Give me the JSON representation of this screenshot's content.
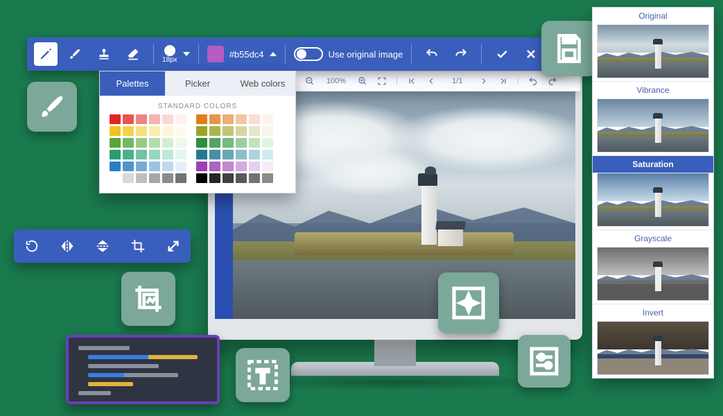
{
  "toolbar": {
    "brush_size_label": "18px",
    "hex_value": "#b55dc4",
    "use_original_label": "Use original image"
  },
  "palette_popup": {
    "tabs": [
      "Palettes",
      "Picker",
      "Web colors"
    ],
    "section_title": "STANDARD COLORS",
    "left_colors": [
      "#e02626",
      "#e85555",
      "#ef8383",
      "#f5b2b2",
      "#fbd8d8",
      "#fef0f0",
      "#f0c419",
      "#f3d34a",
      "#f6e17b",
      "#f9eead",
      "#fcf6d4",
      "#fefbee",
      "#5aa43a",
      "#78b85f",
      "#96cb84",
      "#b5dda9",
      "#d3eecf",
      "#edf8ea",
      "#2a9d6f",
      "#4eb089",
      "#73c3a3",
      "#98d6bd",
      "#bde9d7",
      "#e2f6ef",
      "#2b7ec2",
      "#5094cd",
      "#76abd9",
      "#9bc2e4",
      "#c1d9ef",
      "#e4efF9",
      "#ffffff",
      "#d9d9d9",
      "#bfbfbf",
      "#a6a6a6",
      "#8c8c8c",
      "#737373"
    ],
    "right_colors": [
      "#e07d1b",
      "#e69648",
      "#ecae75",
      "#f2c7a2",
      "#f8dfcf",
      "#fdf3ea",
      "#9aa524",
      "#adb54d",
      "#c0c577",
      "#d3d6a0",
      "#e6e6c9",
      "#f6f6ea",
      "#2e8f3e",
      "#52a45e",
      "#77b97f",
      "#9bcd9f",
      "#c0e2c0",
      "#e4f4e4",
      "#237a8d",
      "#4591a1",
      "#68a7b5",
      "#8abec9",
      "#acd4dd",
      "#d0ebf0",
      "#9b3fb3",
      "#af63c2",
      "#c287d1",
      "#d6abe0",
      "#e9cfef",
      "#f6ecf8",
      "#000000",
      "#262626",
      "#404040",
      "#595959",
      "#737373",
      "#8c8c8c"
    ]
  },
  "viewer_toolbar": {
    "zoom": "100%",
    "page_indicator": "1/1"
  },
  "filters": {
    "items": [
      {
        "label": "Original",
        "cls": ""
      },
      {
        "label": "Vibrance",
        "cls": "vib"
      },
      {
        "label": "Saturation",
        "cls": "sat",
        "selected": true
      },
      {
        "label": "Grayscale",
        "cls": "gray"
      },
      {
        "label": "Invert",
        "cls": "inv"
      }
    ]
  },
  "icons": {
    "pencil": "pencil-icon",
    "brush": "brush-icon",
    "stamp": "stamp-icon",
    "eraser": "eraser-icon",
    "undo": "undo-icon",
    "redo": "redo-icon",
    "apply": "check-icon",
    "cancel": "close-icon",
    "save": "save-icon",
    "crop_image": "crop-image-icon",
    "sparkle_image": "sparkle-image-icon",
    "sliders": "sliders-icon",
    "text_frame": "text-frame-icon",
    "image_frame": "image-frame-icon"
  }
}
